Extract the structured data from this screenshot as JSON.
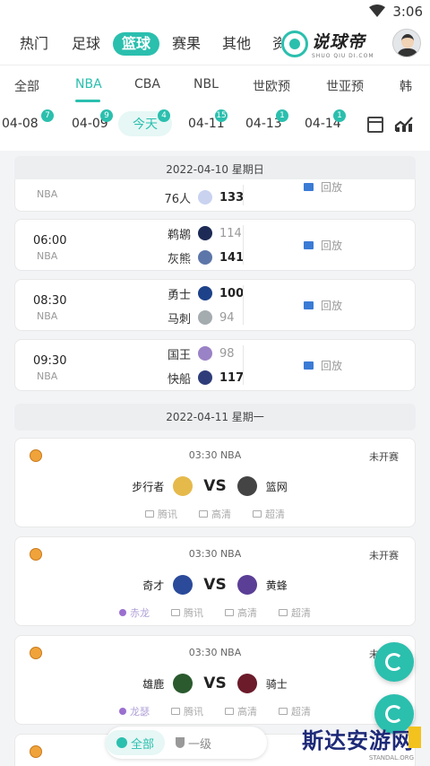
{
  "status_bar": {
    "time": "3:06"
  },
  "top_nav": {
    "tabs": [
      "热门",
      "足球",
      "篮球",
      "赛果",
      "其他",
      "资"
    ],
    "active_tab": "篮球"
  },
  "brand": {
    "name": "说球帝",
    "sub": "SHUO QIU DI.COM"
  },
  "leagues": {
    "items": [
      "全部",
      "NBA",
      "CBA",
      "NBL",
      "世欧预",
      "世亚预",
      "韩"
    ],
    "active": "NBA"
  },
  "dates": {
    "items": [
      {
        "label": "04-08",
        "badge": "7"
      },
      {
        "label": "04-09",
        "badge": "9"
      },
      {
        "label": "今天",
        "badge": "4"
      },
      {
        "label": "04-11",
        "badge": "15"
      },
      {
        "label": "04-13",
        "badge": "1"
      },
      {
        "label": "04-14",
        "badge": "1"
      }
    ]
  },
  "section1": {
    "header": "2022-04-10 星期日",
    "matches": [
      {
        "time": "",
        "league": "NBA",
        "home": "",
        "home_score": "",
        "away": "76人",
        "away_score": "133",
        "replay": "回放"
      },
      {
        "time": "06:00",
        "league": "NBA",
        "home": "鹈鹕",
        "home_score": "114",
        "away": "灰熊",
        "away_score": "141",
        "replay": "回放"
      },
      {
        "time": "08:30",
        "league": "NBA",
        "home": "勇士",
        "home_score": "100",
        "away": "马刺",
        "away_score": "94",
        "replay": "回放"
      },
      {
        "time": "09:30",
        "league": "NBA",
        "home": "国王",
        "home_score": "98",
        "away": "快船",
        "away_score": "117",
        "replay": "回放"
      }
    ]
  },
  "section2": {
    "header": "2022-04-11 星期一",
    "matches": [
      {
        "info": "03:30 NBA",
        "status": "未开赛",
        "home": "步行者",
        "away": "篮网",
        "vs": "VS",
        "streams": [
          "腾讯",
          "高清",
          "超清"
        ],
        "anchor": ""
      },
      {
        "info": "03:30 NBA",
        "status": "未开赛",
        "home": "奇才",
        "away": "黄蜂",
        "vs": "VS",
        "streams": [
          "腾讯",
          "高清",
          "超清"
        ],
        "anchor": "赤龙"
      },
      {
        "info": "03:30 NBA",
        "status": "未开赛",
        "home": "雄鹿",
        "away": "骑士",
        "vs": "VS",
        "streams": [
          "腾讯",
          "高清",
          "超清"
        ],
        "anchor": "龙瑟"
      }
    ]
  },
  "bottom_filter": {
    "all": "全部",
    "level1": "一级"
  },
  "watermark": {
    "main": "斯达安游网",
    "sub": "STANDAL.ORG"
  },
  "colors": {
    "accent": "#2bbfae",
    "replay_icon": "#3a7bd5"
  }
}
